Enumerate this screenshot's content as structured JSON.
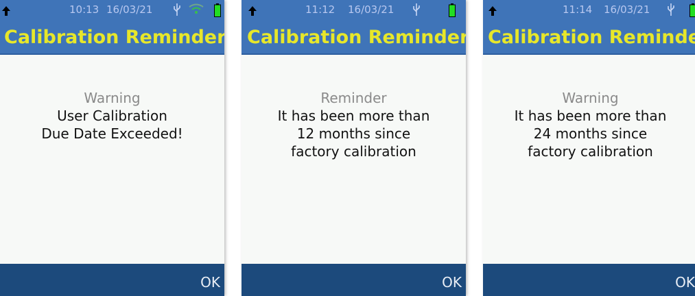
{
  "colors": {
    "status_bar": "#3f74b8",
    "title_text": "#e7e72a",
    "screen_background": "#f7f9f7",
    "footer_bar": "#1c4a7c",
    "battery_fill": "#22dd22"
  },
  "screens": [
    {
      "status": {
        "time": "10:13",
        "date": "16/03/21",
        "usb_icon": "usb-icon",
        "wifi_icon": "wifi-icon",
        "battery_icon": "battery-icon"
      },
      "title": "Calibration Reminder",
      "message": {
        "heading": "Warning",
        "lines": [
          "User Calibration",
          "Due Date Exceeded!"
        ]
      },
      "ok_label": "OK"
    },
    {
      "status": {
        "time": "11:12",
        "date": "16/03/21",
        "usb_icon": "usb-icon",
        "battery_icon": "battery-icon"
      },
      "title": "Calibration Reminder",
      "message": {
        "heading": "Reminder",
        "lines": [
          "It has been more than",
          "12 months since",
          "factory calibration"
        ]
      },
      "ok_label": "OK"
    },
    {
      "status": {
        "time": "11:14",
        "date": "16/03/21",
        "usb_icon": "usb-icon",
        "battery_icon": "battery-icon"
      },
      "title": "Calibration Reminder",
      "message": {
        "heading": "Warning",
        "lines": [
          "It has been more than",
          "24 months since",
          "factory calibration"
        ]
      },
      "ok_label": "OK"
    }
  ]
}
